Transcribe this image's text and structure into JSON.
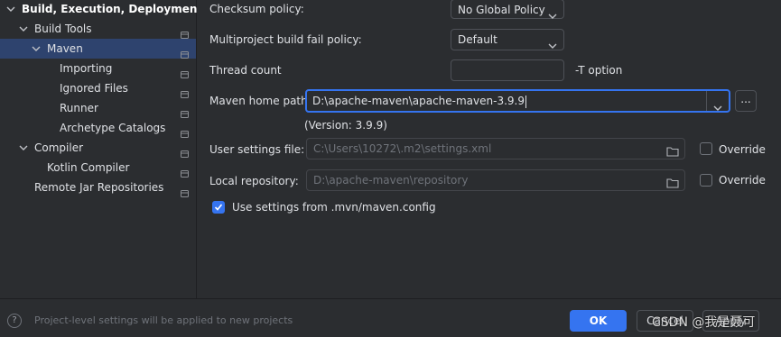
{
  "sidebar": {
    "items": [
      {
        "label": "Build, Execution, Deployment",
        "expanded": true
      },
      {
        "label": "Build Tools",
        "expanded": true
      },
      {
        "label": "Maven",
        "expanded": true,
        "selected": true
      },
      {
        "label": "Importing"
      },
      {
        "label": "Ignored Files"
      },
      {
        "label": "Runner"
      },
      {
        "label": "Archetype Catalogs"
      },
      {
        "label": "Compiler",
        "expanded": true
      },
      {
        "label": "Kotlin Compiler"
      },
      {
        "label": "Remote Jar Repositories"
      }
    ]
  },
  "settings": {
    "checksum_label": "Checksum policy:",
    "checksum_value": "No Global Policy",
    "multiproject_label": "Multiproject build fail policy:",
    "multiproject_value": "Default",
    "thread_label": "Thread count",
    "thread_value": "",
    "thread_hint": "-T option",
    "maven_home_label": "Maven home path:",
    "maven_home_value": "D:\\apache-maven\\apache-maven-3.9.9",
    "browse_label": "...",
    "version_text": "(Version: 3.9.9)",
    "user_settings_label": "User settings file:",
    "user_settings_value": "C:\\Users\\10272\\.m2\\settings.xml",
    "override_label": "Override",
    "local_repo_label": "Local repository:",
    "local_repo_value": "D:\\apache-maven\\repository",
    "use_mvn_config_label": "Use settings from .mvn/maven.config",
    "use_mvn_config_checked": true
  },
  "footer": {
    "help_symbol": "?",
    "note": "Project-level settings will be applied to new projects",
    "ok_label": "OK",
    "cancel_label": "Cancel",
    "apply_label": "Apply",
    "watermark": "CSDN @我是聂可"
  },
  "colors": {
    "background": "#2b2d30",
    "selection": "#2e436e",
    "accent": "#3574f0"
  }
}
